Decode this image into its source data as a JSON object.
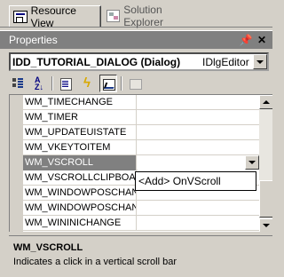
{
  "tabs": [
    {
      "label": "Resource View",
      "icon": "resource-view-icon",
      "active": true
    },
    {
      "label": "Solution Explorer",
      "icon": "solution-explorer-icon",
      "active": false
    }
  ],
  "panel": {
    "title": "Properties",
    "pin_icon": "pin-icon",
    "close_icon": "close-icon"
  },
  "object_selector": {
    "name": "IDD_TUTORIAL_DIALOG (Dialog)",
    "type": "IDlgEditor"
  },
  "toolbar": {
    "buttons": [
      "categorized-icon",
      "alphabetical-icon",
      "properties-icon",
      "events-icon",
      "messages-icon",
      "overrides-icon"
    ],
    "pressed": "messages-icon"
  },
  "grid": {
    "rows": [
      {
        "name": "WM_TIMECHANGE",
        "value": ""
      },
      {
        "name": "WM_TIMER",
        "value": ""
      },
      {
        "name": "WM_UPDATEUISTATE",
        "value": ""
      },
      {
        "name": "WM_VKEYTOITEM",
        "value": ""
      },
      {
        "name": "WM_VSCROLL",
        "value": "",
        "selected": true
      },
      {
        "name": "WM_VSCROLLCLIPBOARD",
        "value": ""
      },
      {
        "name": "WM_WINDOWPOSCHANGED",
        "value": ""
      },
      {
        "name": "WM_WINDOWPOSCHANGING",
        "value": ""
      },
      {
        "name": "WM_WININICHANGE",
        "value": ""
      }
    ]
  },
  "dropdown": {
    "option": "<Add> OnVScroll"
  },
  "description": {
    "title": "WM_VSCROLL",
    "text": "Indicates a click in a vertical scroll bar"
  },
  "colors": {
    "panel_bg": "#d4d0c8",
    "header_bg": "#808080",
    "selection_bg": "#808080"
  }
}
